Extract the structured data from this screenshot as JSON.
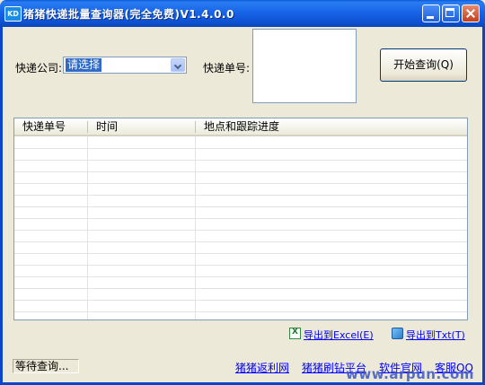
{
  "window": {
    "icon_text": "KD",
    "title": "猪猪快递批量查询器(完全免费)V1.4.0.0"
  },
  "form": {
    "company_label": "快递公司:",
    "company_selected": "请选择",
    "tracking_label": "快递单号:",
    "tracking_value": "",
    "query_button": "开始查询(Q)"
  },
  "table": {
    "columns": [
      "快递单号",
      "时间",
      "地点和跟踪进度"
    ],
    "rows": []
  },
  "exports": {
    "excel": "导出到Excel(E)",
    "txt": "导出到Txt(T)"
  },
  "status": {
    "text": "等待查询..."
  },
  "footer": {
    "links": [
      "猪猪返利网",
      "猪猪刷钻平台",
      "软件官网",
      "客服QQ"
    ]
  },
  "watermark": "www.arpun.com"
}
